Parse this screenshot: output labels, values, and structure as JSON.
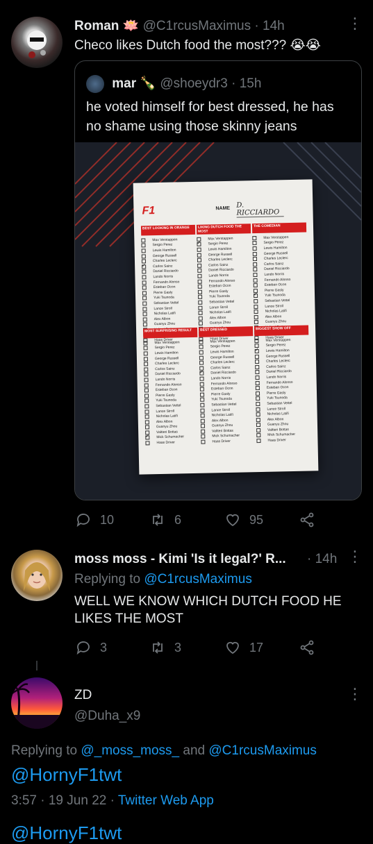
{
  "tweet1": {
    "display_name": "Roman",
    "badge_emoji": "🪷",
    "handle": "@C1rcusMaximus",
    "separator": "·",
    "time": "14h",
    "text": "Checo likes Dutch food the most??? 😭😭",
    "quote": {
      "display_name": "mar",
      "badge_emoji": "🍾",
      "handle": "@shoeydr3",
      "separator": "·",
      "time": "15h",
      "text": "he voted himself for best dressed, he has no shame using those skinny jeans",
      "ballot": {
        "logo": "F1",
        "name_label": "NAME",
        "name_value": "D. RICCIARDO",
        "drivers": [
          "Max Verstappen",
          "Sergio Perez",
          "Lewis Hamilton",
          "George Russell",
          "Charles Leclerc",
          "Carlos Sainz",
          "Daniel Ricciardo",
          "Lando Norris",
          "Fernando Alonso",
          "Esteban Ocon",
          "Pierre Gasly",
          "Yuki Tsunoda",
          "Sebastian Vettel",
          "Lance Stroll",
          "Nicholas Latifi",
          "Alex Albon",
          "Guanyu Zhou",
          "Valtteri Bottas",
          "Mick Schumacher",
          "Haas Driver"
        ],
        "categories": [
          {
            "title": "BEST LOOKING IN ORANGE",
            "checked": 5
          },
          {
            "title": "LIKING DUTCH FOOD THE MOST",
            "checked": 1
          },
          {
            "title": "THE COMEDIAN",
            "checked": 11
          },
          {
            "title": "MOST SURPRISING RESULT",
            "checked": 18
          },
          {
            "title": "BEST DRESSED",
            "checked": 6
          },
          {
            "title": "BIGGEST SHOW OFF",
            "checked": 2
          }
        ]
      }
    },
    "replies": "10",
    "retweets": "6",
    "likes": "95"
  },
  "tweet2": {
    "display_name": "moss moss - Kimi 'Is it legal?' R...",
    "separator": "·",
    "time": "14h",
    "replying_prefix": "Replying to",
    "replying_to": "@C1rcusMaximus",
    "text": "WELL WE KNOW WHICH DUTCH FOOD HE LIKES THE MOST",
    "replies": "3",
    "retweets": "3",
    "likes": "17"
  },
  "tweet3": {
    "display_name": "ZD",
    "handle": "@Duha_x9",
    "replying_prefix": "Replying to",
    "replying_to_1": "@_moss_moss_",
    "replying_and": "and",
    "replying_to_2": "@C1rcusMaximus",
    "text": "@HornyF1twt",
    "date": "3:57 · 19 Jun 22 ·",
    "source": "Twitter Web App",
    "cutoff_text": "@HornyF1twt"
  },
  "colors": {
    "background": "#000000",
    "text": "#e7e9ea",
    "muted": "#71767b",
    "link": "#1d9bf0",
    "ballot_red": "#d41e1e"
  }
}
